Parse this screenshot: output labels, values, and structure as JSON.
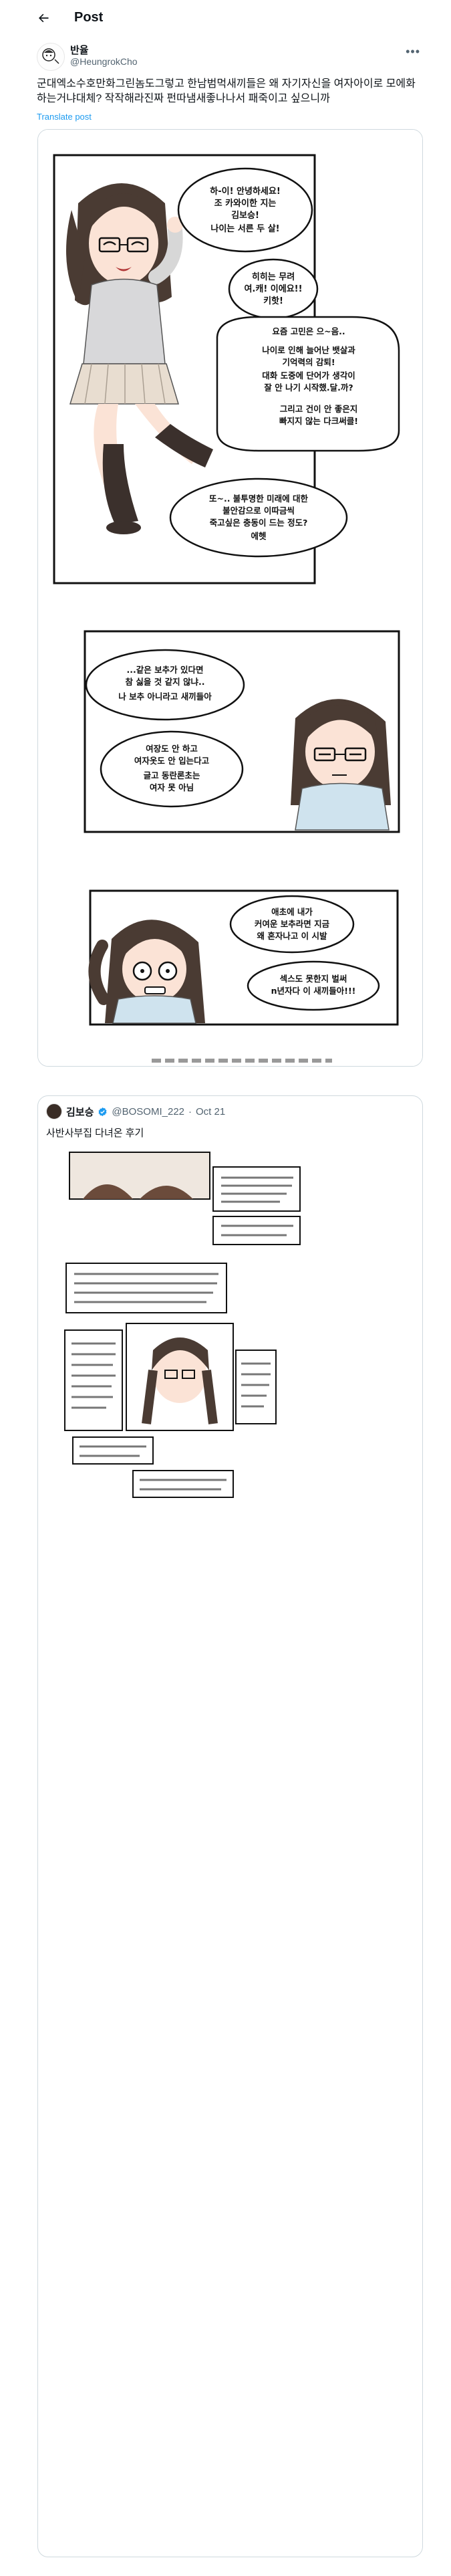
{
  "header": {
    "title": "Post"
  },
  "tweet": {
    "display_name": "반율",
    "handle": "@HeungrokCho",
    "text": "군대엑소수호만화그린놈도그렇고 한남범먹새끼들은 왜 자기자신을 여자아이로 모에화하는거냐대체? 작작해라진짜 펀따냄새좋나나서 패죽이고 싶으니까",
    "translate_label": "Translate post"
  },
  "comic": {
    "panel1": {
      "bubble1": [
        "하-이! 안녕하세요!",
        "조 카와이한 지는",
        "김보승!",
        "나이는 서른 두 살!"
      ],
      "bubble2": [
        "히히는 무려",
        "여.캐! 이에요!!",
        "키핫!"
      ],
      "bubble3": [
        "요즘 고민은 으~음..",
        "나이로 인해 늘어난 뱃살과",
        "기억력의 감퇴!",
        "대화 도중에 단어가 생각이",
        "잘 안 나기 시작했.달.까?",
        "그리고 건이 안 좋은지",
        "빠지지 않는 다크써클!"
      ],
      "bubble4": [
        "또~.. 불투명한 미래에 대한",
        "불안감으로 이따금씩",
        "죽고싶은 충동이 드는 정도?",
        "에헷"
      ]
    },
    "panel2": {
      "bubble1": [
        "...같은 보추가 있다면",
        "참 싫을 것 같지 않냐..",
        "나 보추 아니라고 새끼들아"
      ],
      "bubble2": [
        "여장도 안 하고",
        "여자옷도 안 입는다고",
        "글고 동란론초는",
        "여자 못 아님"
      ]
    },
    "panel3": {
      "bubble1": [
        "애초에 내가",
        "커여운 보추라면 지금",
        "왜 혼자나고 이 시발"
      ],
      "bubble2": [
        "섹스도 못한지 벌써",
        "n년자다 이 새끼들아!!!"
      ]
    }
  },
  "quote": {
    "display_name": "김보승",
    "handle": "@BOSOMI_222",
    "date": "Oct 21",
    "text": "사반사부집 다녀온 후기"
  }
}
